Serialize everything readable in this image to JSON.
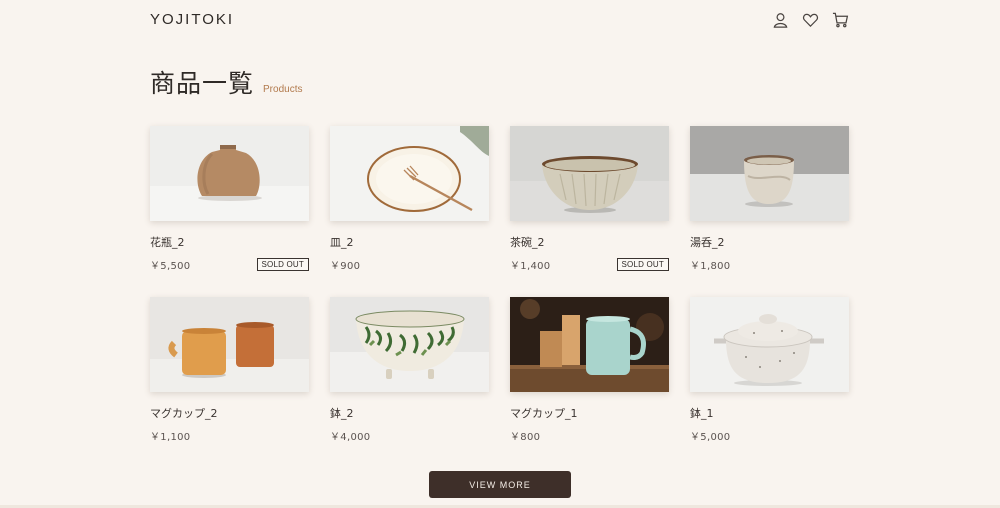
{
  "header": {
    "logo": "YOJITOKI",
    "icons": [
      "user-icon",
      "heart-icon",
      "cart-icon"
    ]
  },
  "page_title": {
    "jp": "商品一覧",
    "en": "Products"
  },
  "products": [
    {
      "name": "花瓶_2",
      "price": "￥5,500",
      "badge": "SOLD OUT",
      "image": "vase"
    },
    {
      "name": "皿_2",
      "price": "￥900",
      "badge": "",
      "image": "plate"
    },
    {
      "name": "茶碗_2",
      "price": "￥1,400",
      "badge": "SOLD OUT",
      "image": "rice-bowl"
    },
    {
      "name": "湯呑_2",
      "price": "￥1,800",
      "badge": "",
      "image": "teacup"
    },
    {
      "name": "マグカップ_2",
      "price": "￥1,100",
      "badge": "",
      "image": "mugs"
    },
    {
      "name": "鉢_2",
      "price": "￥4,000",
      "badge": "",
      "image": "footed-bowl"
    },
    {
      "name": "マグカップ_1",
      "price": "￥800",
      "badge": "",
      "image": "mug"
    },
    {
      "name": "鉢_1",
      "price": "￥5,000",
      "badge": "",
      "image": "casserole"
    }
  ],
  "view_more_label": "VIEW MORE",
  "colors": {
    "background": "#f9f4ef",
    "accent": "#b27a4d",
    "button": "#3e2f29"
  }
}
